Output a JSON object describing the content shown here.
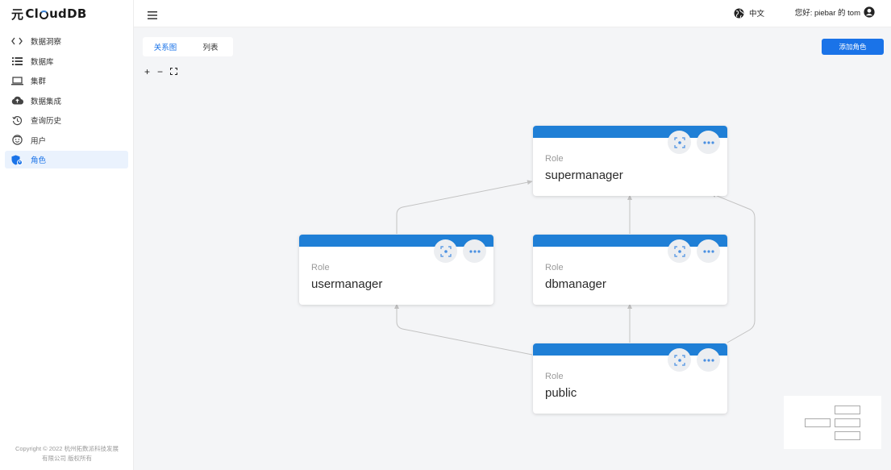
{
  "app": {
    "logo": {
      "prefix": "元",
      "cl": "Cl",
      "rest": "udDB"
    }
  },
  "sidebar": {
    "items": [
      {
        "label": "数据洞察",
        "icon": "code-icon"
      },
      {
        "label": "数据库",
        "icon": "list-icon"
      },
      {
        "label": "集群",
        "icon": "laptop-icon"
      },
      {
        "label": "数据集成",
        "icon": "cloud-upload-icon"
      },
      {
        "label": "查询历史",
        "icon": "history-icon"
      },
      {
        "label": "用户",
        "icon": "smile-icon"
      },
      {
        "label": "角色",
        "icon": "role-icon",
        "active": true
      }
    ],
    "copyright_line1": "Copyright © 2022 杭州拓数派科技发展",
    "copyright_line2": "有限公司 版权所有"
  },
  "header": {
    "language": "中文",
    "greeting": "您好: piebar 的 tom"
  },
  "main": {
    "tabs": [
      {
        "label": "关系图",
        "active": true
      },
      {
        "label": "列表",
        "active": false
      }
    ],
    "zoom_in": "+",
    "zoom_out": "−",
    "fit": "⛶",
    "add_button": "添加角色"
  },
  "graph": {
    "nodes": [
      {
        "id": "supermanager",
        "type": "Role",
        "name": "supermanager"
      },
      {
        "id": "usermanager",
        "type": "Role",
        "name": "usermanager"
      },
      {
        "id": "dbmanager",
        "type": "Role",
        "name": "dbmanager"
      },
      {
        "id": "public",
        "type": "Role",
        "name": "public"
      }
    ],
    "edges": [
      {
        "from": "usermanager",
        "to": "supermanager"
      },
      {
        "from": "dbmanager",
        "to": "supermanager"
      },
      {
        "from": "public",
        "to": "supermanager"
      },
      {
        "from": "public",
        "to": "usermanager"
      },
      {
        "from": "public",
        "to": "dbmanager"
      }
    ]
  },
  "colors": {
    "accent": "#1a73e8",
    "node_header": "#1f7fd6",
    "edge": "#c2c2c2"
  }
}
